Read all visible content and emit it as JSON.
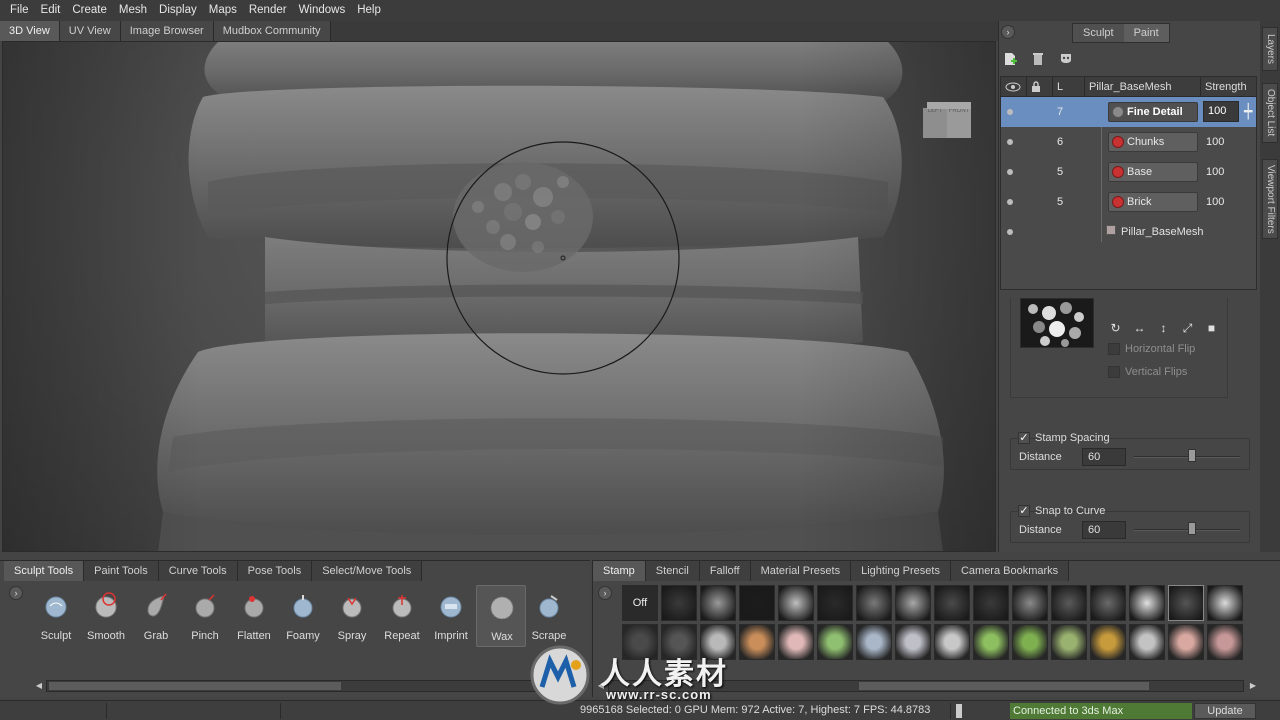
{
  "menu": [
    "File",
    "Edit",
    "Create",
    "Mesh",
    "Display",
    "Maps",
    "Render",
    "Windows",
    "Help"
  ],
  "view_tabs": [
    "3D View",
    "UV View",
    "Image Browser",
    "Mudbox Community"
  ],
  "viewcube": {
    "left": "LEFT",
    "front": "FRONT"
  },
  "panel": {
    "mode_sculpt": "Sculpt",
    "mode_paint": "Paint",
    "side_tabs": [
      "Layers",
      "Object List",
      "Viewport Filters"
    ]
  },
  "layers": {
    "headers": {
      "level": "L",
      "name": "Pillar_BaseMesh",
      "strength": "Strength"
    },
    "rows": [
      {
        "level": "7",
        "name": "Fine Detail",
        "strength": "100"
      },
      {
        "level": "6",
        "name": "Chunks",
        "strength": "100"
      },
      {
        "level": "5",
        "name": "Base",
        "strength": "100"
      },
      {
        "level": "5",
        "name": "Brick",
        "strength": "100"
      }
    ],
    "base_mesh": "Pillar_BaseMesh"
  },
  "stamp_props": {
    "horizontal_flip": "Horizontal Flip",
    "vertical_flips": "Vertical Flips",
    "stamp_spacing": "Stamp Spacing",
    "stamp_spacing_distance_label": "Distance",
    "stamp_spacing_distance": "60",
    "stamp_spacing_slider": 0.55,
    "snap_to_curve": "Snap to Curve",
    "snap_distance_label": "Distance",
    "snap_distance": "60",
    "snap_slider": 0.55
  },
  "tool_tabs": [
    "Sculpt Tools",
    "Paint Tools",
    "Curve Tools",
    "Pose Tools",
    "Select/Move Tools"
  ],
  "tools": [
    "Sculpt",
    "Smooth",
    "Grab",
    "Pinch",
    "Flatten",
    "Foamy",
    "Spray",
    "Repeat",
    "Imprint",
    "Wax",
    "Scrape"
  ],
  "selected_tool": "Wax",
  "stamp_tabs": [
    "Stamp",
    "Stencil",
    "Falloff",
    "Material Presets",
    "Lighting Presets",
    "Camera Bookmarks"
  ],
  "stamp_off": "Off",
  "status": {
    "text": "9965168 Selected: 0 GPU Mem: 972  Active: 7, Highest: 7  FPS: 44.8783",
    "connection": "Connected to 3ds Max",
    "update": "Update"
  },
  "watermark": {
    "text": "人人素材",
    "url": "www.rr-sc.com"
  },
  "colors": {
    "selection": "#6a8ec0",
    "connected": "#4e7a36",
    "layer_icon": "#c83232"
  }
}
